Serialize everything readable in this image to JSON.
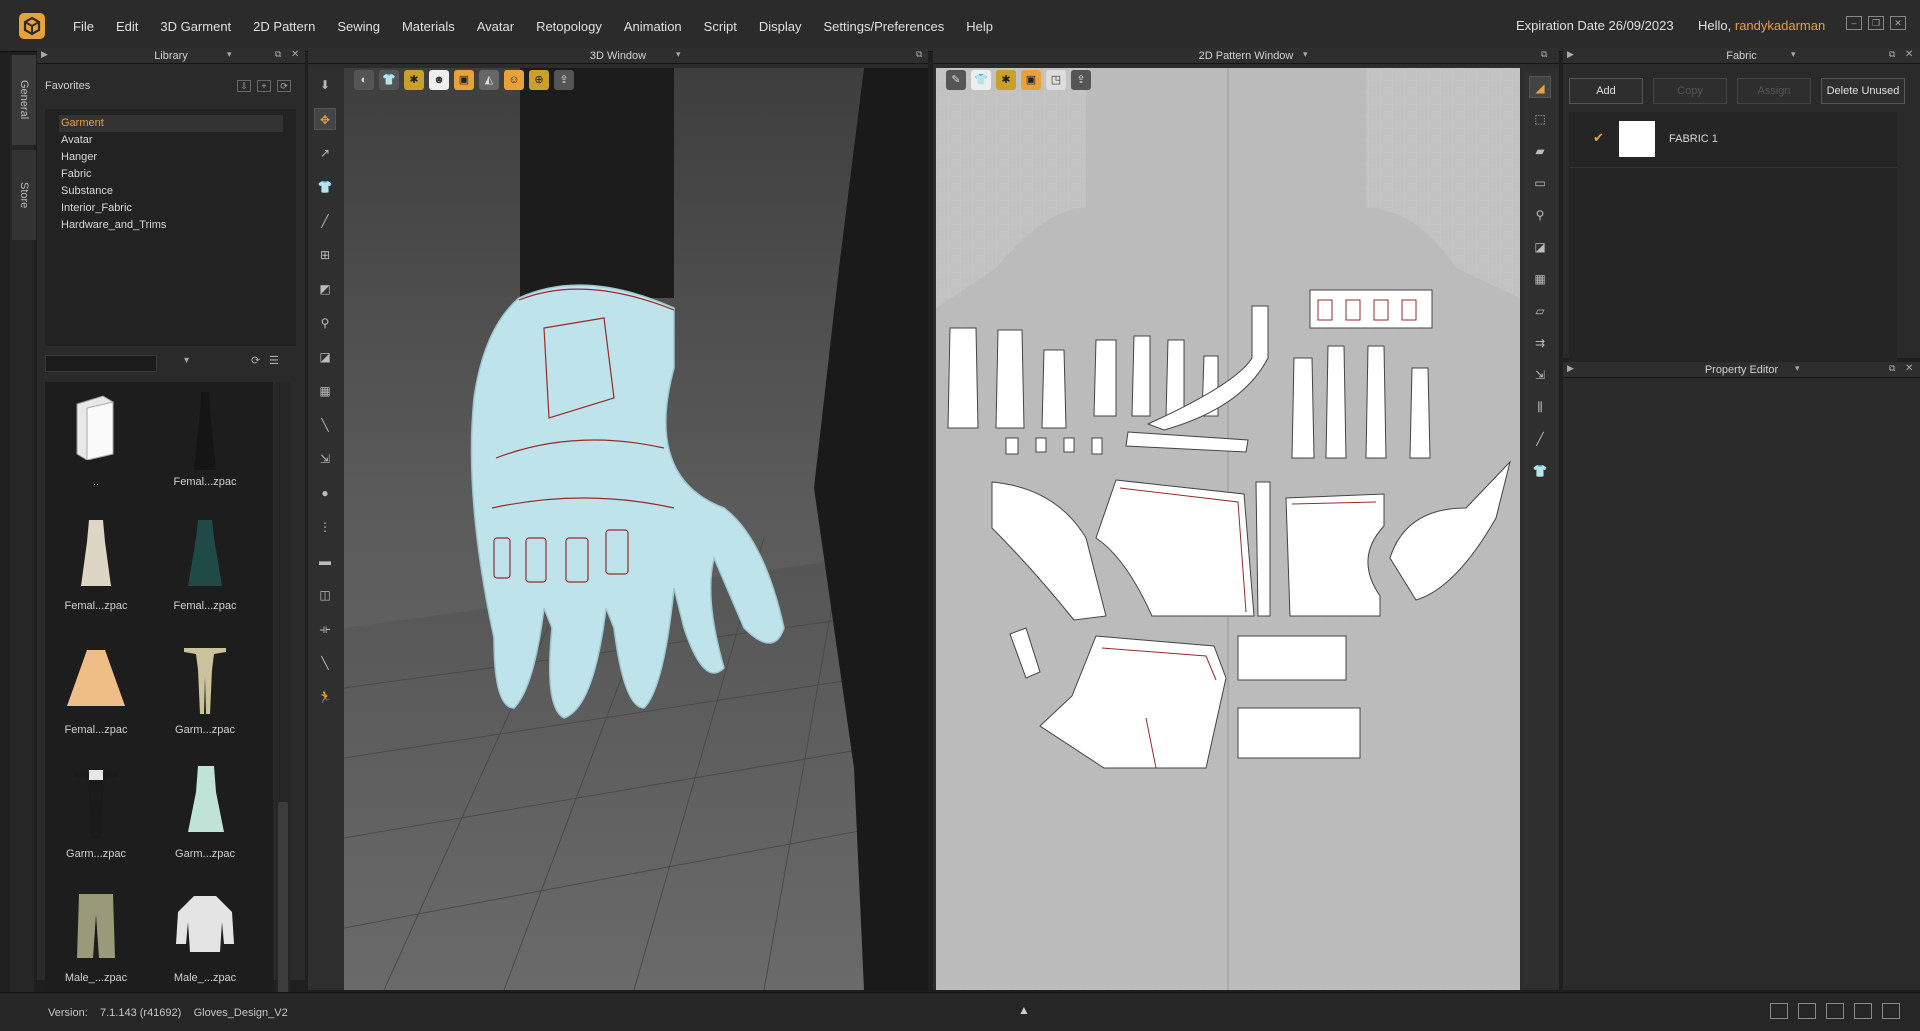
{
  "menubar": {
    "items": [
      "File",
      "Edit",
      "3D Garment",
      "2D Pattern",
      "Sewing",
      "Materials",
      "Avatar",
      "Retopology",
      "Animation",
      "Script",
      "Display",
      "Settings/Preferences",
      "Help"
    ],
    "expiration": "Expiration Date 26/09/2023",
    "hello": "Hello,",
    "username": "randykadarman"
  },
  "sidetabs": {
    "general": "General",
    "store": "Store"
  },
  "library": {
    "title": "Library",
    "favorites_title": "Favorites",
    "favorites": [
      "Garment",
      "Avatar",
      "Hanger",
      "Fabric",
      "Substance",
      "Interior_Fabric",
      "Hardware_and_Trims"
    ],
    "items": [
      {
        "label": "..",
        "icon": "folder-icon"
      },
      {
        "label": "Femal...zpac",
        "icon": "dress-black-thumb"
      },
      {
        "label": "Femal...zpac",
        "icon": "dress-cream-thumb"
      },
      {
        "label": "Femal...zpac",
        "icon": "dress-green-thumb"
      },
      {
        "label": "Femal...zpac",
        "icon": "skirt-orange-thumb"
      },
      {
        "label": "Garm...zpac",
        "icon": "outfit-beige-thumb"
      },
      {
        "label": "Garm...zpac",
        "icon": "outfit-black-thumb"
      },
      {
        "label": "Garm...zpac",
        "icon": "dress-mint-thumb"
      },
      {
        "label": "Male_...zpac",
        "icon": "pants-khaki-thumb"
      },
      {
        "label": "Male_...zpac",
        "icon": "jacket-white-thumb"
      }
    ]
  },
  "view3d": {
    "title": "3D Window"
  },
  "view2d": {
    "title": "2D Pattern Window"
  },
  "fabric": {
    "title": "Fabric",
    "buttons": {
      "add": "Add",
      "copy": "Copy",
      "assign": "Assign",
      "delete_unused": "Delete Unused"
    },
    "items": [
      {
        "name": "FABRIC 1",
        "color": "#ffffff"
      }
    ]
  },
  "property_editor": {
    "title": "Property Editor"
  },
  "status": {
    "version_label": "Version:",
    "version": "7.1.143 (r41692)",
    "project": "Gloves_Design_V2"
  },
  "colors": {
    "accent": "#e8a23a",
    "glove": "#bfe3ea",
    "seam": "#9a2a2a"
  }
}
